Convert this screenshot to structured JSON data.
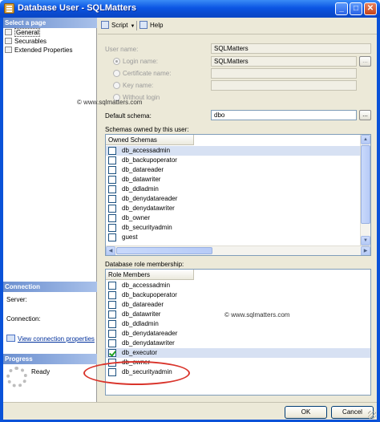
{
  "window": {
    "title": "Database User - SQLMatters",
    "minimize": "_",
    "maximize": "□",
    "close": "✕"
  },
  "left": {
    "select_page_header": "Select a page",
    "pages": [
      {
        "label": "General",
        "selected": true,
        "icon": "page-icon"
      },
      {
        "label": "Securables",
        "selected": false,
        "icon": "page-icon"
      },
      {
        "label": "Extended Properties",
        "selected": false,
        "icon": "page-icon"
      }
    ],
    "connection_header": "Connection",
    "server_label": "Server:",
    "connection_label": "Connection:",
    "view_connection_link": "View connection properties",
    "progress_header": "Progress",
    "progress_status": "Ready"
  },
  "toolbar": {
    "script_label": "Script",
    "help_label": "Help"
  },
  "form": {
    "user_name_label": "User name:",
    "user_name_value": "SQLMatters",
    "login_name_label": "Login name:",
    "login_name_value": "SQLMatters",
    "certificate_name_label": "Certificate name:",
    "certificate_name_value": "",
    "key_name_label": "Key name:",
    "key_name_value": "",
    "without_login_label": "Without login",
    "default_schema_label": "Default schema:",
    "default_schema_value": "dbo",
    "browse_label": "...",
    "schemas_owned_label": "Schemas owned by this user:",
    "schemas_column": "Owned Schemas",
    "schemas": [
      {
        "name": "db_accessadmin",
        "checked": false,
        "highlighted": true
      },
      {
        "name": "db_backupoperator",
        "checked": false,
        "highlighted": false
      },
      {
        "name": "db_datareader",
        "checked": false,
        "highlighted": false
      },
      {
        "name": "db_datawriter",
        "checked": false,
        "highlighted": false
      },
      {
        "name": "db_ddladmin",
        "checked": false,
        "highlighted": false
      },
      {
        "name": "db_denydatareader",
        "checked": false,
        "highlighted": false
      },
      {
        "name": "db_denydatawriter",
        "checked": false,
        "highlighted": false
      },
      {
        "name": "db_owner",
        "checked": false,
        "highlighted": false
      },
      {
        "name": "db_securityadmin",
        "checked": false,
        "highlighted": false
      },
      {
        "name": "guest",
        "checked": false,
        "highlighted": false
      }
    ],
    "role_membership_label": "Database role membership:",
    "roles_column": "Role Members",
    "roles": [
      {
        "name": "db_accessadmin",
        "checked": false,
        "highlighted": false
      },
      {
        "name": "db_backupoperator",
        "checked": false,
        "highlighted": false
      },
      {
        "name": "db_datareader",
        "checked": false,
        "highlighted": false
      },
      {
        "name": "db_datawriter",
        "checked": false,
        "highlighted": false
      },
      {
        "name": "db_ddladmin",
        "checked": false,
        "highlighted": false
      },
      {
        "name": "db_denydatareader",
        "checked": false,
        "highlighted": false
      },
      {
        "name": "db_denydatawriter",
        "checked": false,
        "highlighted": false
      },
      {
        "name": "db_executor",
        "checked": true,
        "highlighted": true
      },
      {
        "name": "db_owner",
        "checked": false,
        "highlighted": false
      },
      {
        "name": "db_securityadmin",
        "checked": false,
        "highlighted": false
      }
    ]
  },
  "watermarks": {
    "top": "© www.sqlmatters.com",
    "bottom": "© www.sqlmatters.com"
  },
  "buttons": {
    "ok": "OK",
    "cancel": "Cancel"
  }
}
